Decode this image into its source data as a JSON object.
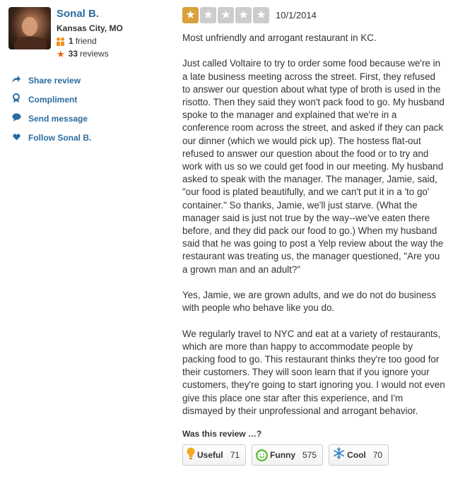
{
  "user": {
    "name": "Sonal B.",
    "location": "Kansas City, MO",
    "friends_count": "1",
    "friends_label": "friend",
    "reviews_count": "33",
    "reviews_label": "reviews"
  },
  "actions": [
    {
      "label": "Share review",
      "icon": "share-arrow-icon"
    },
    {
      "label": "Compliment",
      "icon": "ribbon-icon"
    },
    {
      "label": "Send message",
      "icon": "speech-bubble-icon"
    },
    {
      "label": "Follow Sonal B.",
      "icon": "heart-icon"
    }
  ],
  "review": {
    "rating": 1,
    "max_rating": 5,
    "date": "10/1/2014",
    "paragraphs": [
      "Most unfriendly and arrogant restaurant in KC.",
      "Just called Voltaire to try to order some food because we're in a late business meeting across the street.  First, they refused to answer our question about what type of broth is used in the risotto.  Then they said they won't pack food to go.  My husband spoke to the manager and explained that we're in a conference room across the street, and asked if they can pack our dinner (which we would pick up).  The hostess flat-out refused to answer our question about the food or to try and work with us so we could get food in our meeting.  My husband asked to speak with the manager.  The manager, Jamie, said, \"our food is plated beautifully, and we can't put it in a 'to go' container.\"  So thanks, Jamie, we'll just starve. (What the manager said is just not true by the way--we've eaten there before, and they did pack our food to go.)  When my husband said that he was going to post a Yelp review about the way the restaurant was treating us, the manager questioned, \"Are you a grown man and an adult?\"",
      "Yes, Jamie, we are grown adults, and we do not do business with people who behave like you do.",
      "We regularly travel to NYC and eat at a variety of restaurants, which are more than happy to accommodate people by packing food to go.  This restaurant thinks they're too good for their customers.  They will soon learn that if you ignore your customers, they're going to start ignoring you.  I would not even give this place one star after this experience, and I'm dismayed by their unprofessional and arrogant behavior."
    ]
  },
  "feedback": {
    "question": "Was this review …?",
    "useful": {
      "label": "Useful",
      "count": "71"
    },
    "funny": {
      "label": "Funny",
      "count": "575"
    },
    "cool": {
      "label": "Cool",
      "count": "70"
    }
  },
  "colors": {
    "link": "#2c6da0",
    "star_on": "#d8a13b",
    "star_off": "#cccccc",
    "reviews_star": "#f25c05",
    "friend_icon": "#f48f1f"
  }
}
